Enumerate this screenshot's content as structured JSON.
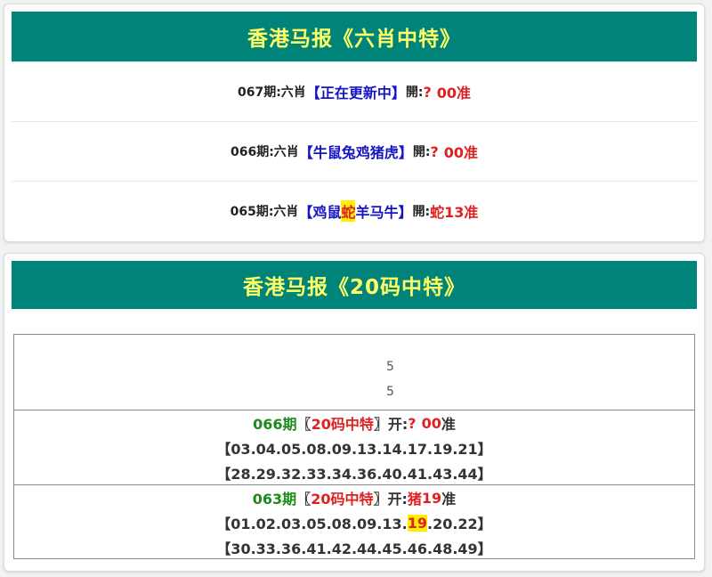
{
  "section1": {
    "title": "香港马报《六肖中特》",
    "rows": [
      {
        "period": "067期:六肖",
        "open_bracket": "【",
        "animals": [
          "正在更新中"
        ],
        "highlight_index": -1,
        "close_bracket": "】",
        "open_label": "開:",
        "result": "?",
        "score": "00准"
      },
      {
        "period": "066期:六肖",
        "open_bracket": "【",
        "animals": [
          "牛鼠兔鸡猪虎"
        ],
        "highlight_index": -1,
        "close_bracket": "】",
        "open_label": "開:",
        "result": "?",
        "score": "00准"
      },
      {
        "period": "065期:六肖",
        "open_bracket": "【",
        "animals": [
          "鸡鼠",
          "蛇",
          "羊马牛"
        ],
        "highlight_index": 1,
        "close_bracket": "】",
        "open_label": "開:",
        "result": "蛇",
        "score": "13准"
      }
    ]
  },
  "section2": {
    "title": "香港马报《20码中特》",
    "masked_fragments": [
      "5",
      "5"
    ],
    "entries": [
      {
        "period": "066期",
        "bracket_open": "〖",
        "type": "20码中特",
        "bracket_close": "〗",
        "open_label": "开:",
        "result": "?",
        "score": "00",
        "score_suffix": "准",
        "line1": "【03.04.05.08.09.13.14.17.19.21】",
        "line2": "【28.29.32.33.34.36.40.41.43.44】"
      },
      {
        "period": "063期",
        "bracket_open": "〖",
        "type": "20码中特",
        "bracket_close": "〗",
        "open_label": "开:",
        "result": "猪",
        "score": "19",
        "score_suffix": "准",
        "line1_pre": "【01.02.03.05.08.09.13.",
        "line1_hl": "19",
        "line1_post": ".20.22】",
        "line2": "【30.33.36.41.42.44.45.46.48.49】"
      }
    ]
  }
}
